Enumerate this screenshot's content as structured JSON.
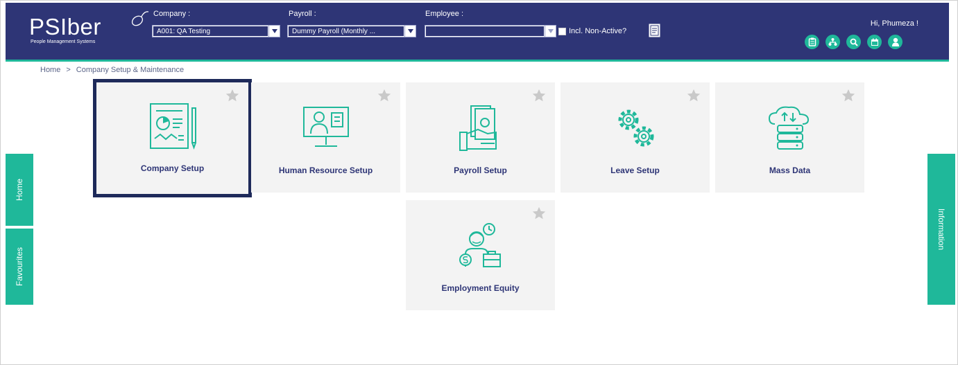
{
  "app": {
    "logo_text": "PSIber",
    "logo_subtitle": "People Management Systems"
  },
  "header": {
    "company_label": "Company :",
    "company_value": "A001: QA Testing",
    "payroll_label": "Payroll :",
    "payroll_value": "Dummy Payroll  (Monthly ...",
    "employee_label": "Employee :",
    "employee_value": "",
    "include_nonactive_label": "Incl. Non-Active?",
    "include_nonactive_checked": false,
    "greeting": "Hi, Phumeza !",
    "icons": [
      "clipboard-icon",
      "org-chart-icon",
      "search-icon",
      "calendar-icon",
      "user-icon"
    ],
    "accent_color": "#1fb89a",
    "bar_color": "#2e3576"
  },
  "breadcrumb": {
    "home": "Home",
    "separator": ">",
    "current": "Company Setup & Maintenance"
  },
  "tiles": [
    {
      "label": "Company Setup",
      "icon": "report-icon",
      "selected": true
    },
    {
      "label": "Human Resource Setup",
      "icon": "monitor-profile-icon",
      "selected": false
    },
    {
      "label": "Payroll Setup",
      "icon": "money-hand-icon",
      "selected": false
    },
    {
      "label": "Leave Setup",
      "icon": "gears-icon",
      "selected": false
    },
    {
      "label": "Mass Data",
      "icon": "cloud-server-icon",
      "selected": false
    },
    {
      "label": "Employment Equity",
      "icon": "employee-equity-icon",
      "selected": false
    }
  ],
  "side_tabs": {
    "home": "Home",
    "favourites": "Favourites",
    "information": "Information"
  }
}
